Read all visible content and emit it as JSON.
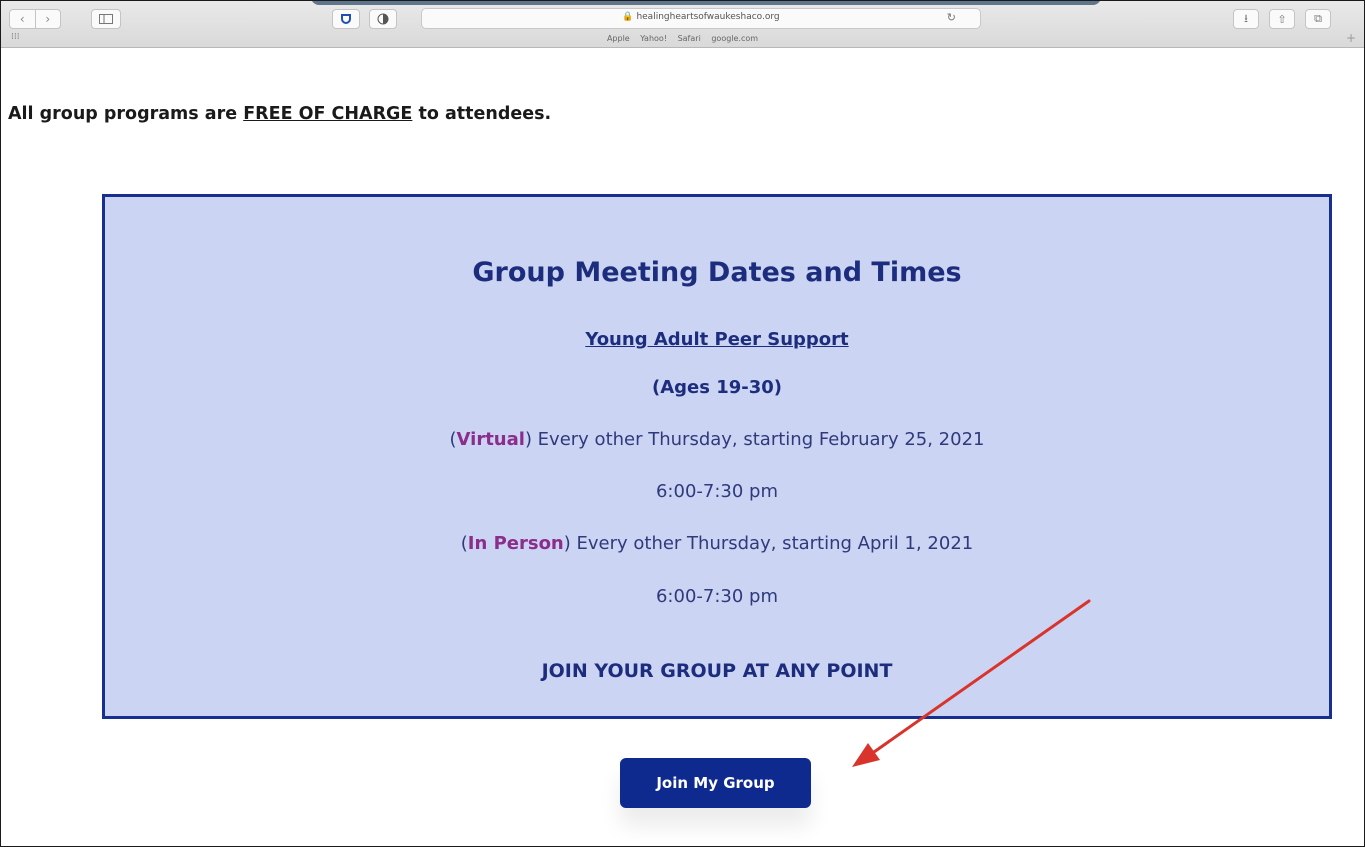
{
  "browser": {
    "url": "healingheartsofwaukeshaco.org",
    "favorites": [
      "Apple",
      "Yahoo!",
      "Safari",
      "google.com"
    ]
  },
  "page": {
    "notice_prefix": "All group programs are ",
    "notice_link": "FREE OF CHARGE",
    "notice_suffix": " to attendees.",
    "panel": {
      "heading": "Group Meeting Dates and Times",
      "subheading": "Young Adult Peer Support",
      "ages": "(Ages 19-30)",
      "session1_tag": "Virtual",
      "session1_text": ") Every other Thursday, starting February 25, 2021",
      "session1_time": "6:00-7:30 pm",
      "session2_tag": "In Person",
      "session2_text": ") Every other Thursday, starting April 1, 2021",
      "session2_time": "6:00-7:30 pm",
      "join_note": "JOIN YOUR GROUP AT ANY POINT"
    },
    "button_label": "Join My Group"
  },
  "colors": {
    "panel_bg": "#ccd4f3",
    "panel_border": "#17308f",
    "button_bg": "#0f2a8e",
    "tag": "#8b2d8a",
    "arrow": "#d9342b"
  }
}
